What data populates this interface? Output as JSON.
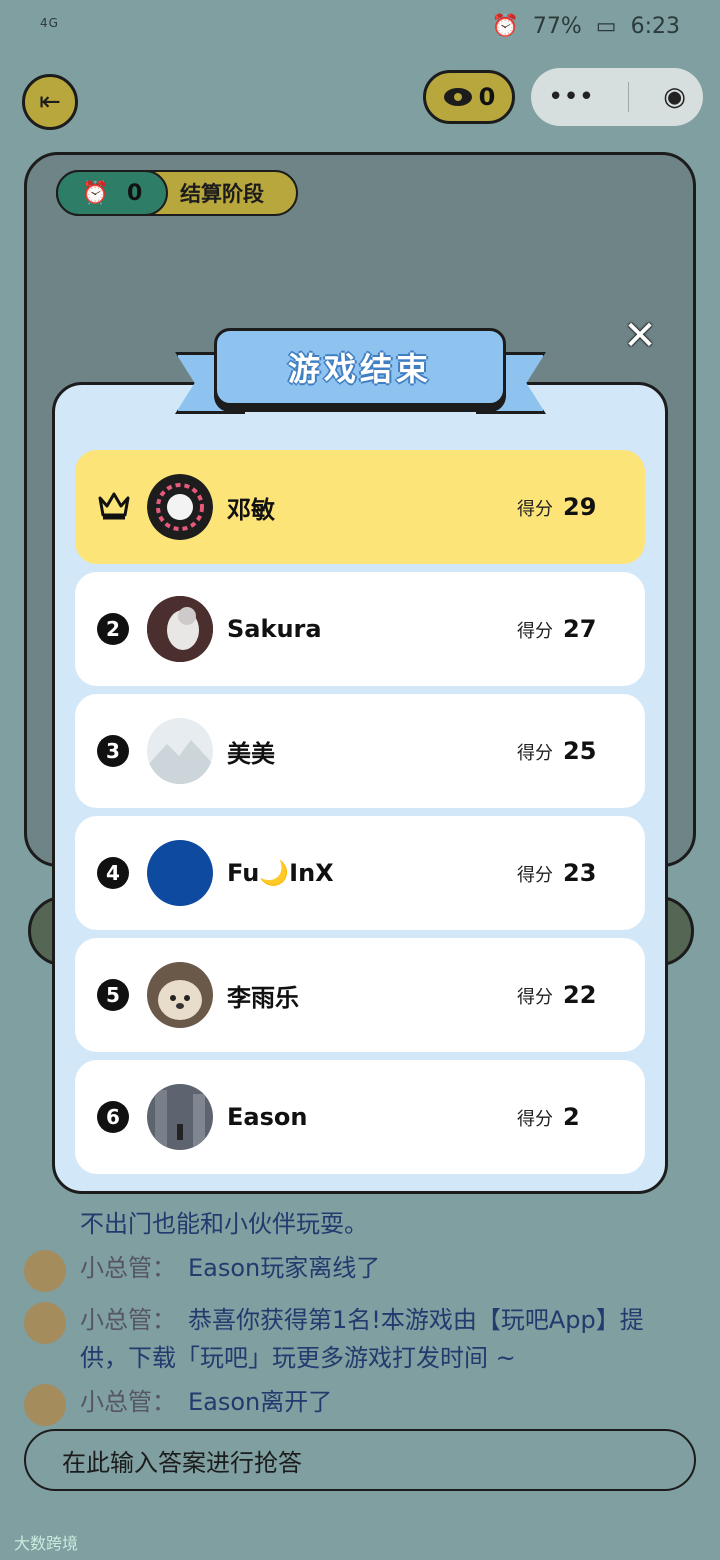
{
  "status_bar": {
    "network": "4G",
    "battery": "77%",
    "time": "6:23"
  },
  "header": {
    "viewer_count": "0"
  },
  "game": {
    "timer_value": "0",
    "phase_label": "结算阶段"
  },
  "modal": {
    "title": "游戏结束",
    "close_label": "✕",
    "score_label": "得分",
    "players": [
      {
        "rank": "1",
        "name": "邓敏",
        "score": "29",
        "avatar_color": "#1d1d1d"
      },
      {
        "rank": "2",
        "name": "Sakura",
        "score": "27",
        "avatar_color": "#4b2e2e"
      },
      {
        "rank": "3",
        "name": "美美",
        "score": "25",
        "avatar_color": "#d9e2e7"
      },
      {
        "rank": "4",
        "name": "Fu🌙InX",
        "score": "23",
        "avatar_color": "#0d4aa0"
      },
      {
        "rank": "5",
        "name": "李雨乐",
        "score": "22",
        "avatar_color": "#b9a48a"
      },
      {
        "rank": "6",
        "name": "Eason",
        "score": "2",
        "avatar_color": "#5d6470"
      }
    ]
  },
  "chat": {
    "messages": [
      {
        "sender": "",
        "text": "不出门也能和小伙伴玩耍。"
      },
      {
        "sender": "小总管：",
        "text": "Eason玩家离线了"
      },
      {
        "sender": "小总管：",
        "text": "恭喜你获得第1名!本游戏由【玩吧App】提"
      },
      {
        "sender": "",
        "text": "供，下载「玩吧」玩更多游戏打发时间 ~"
      },
      {
        "sender": "小总管：",
        "text": "Eason离开了"
      }
    ]
  },
  "answer_input": {
    "placeholder": "在此输入答案进行抢答"
  },
  "watermark": "大数跨境"
}
